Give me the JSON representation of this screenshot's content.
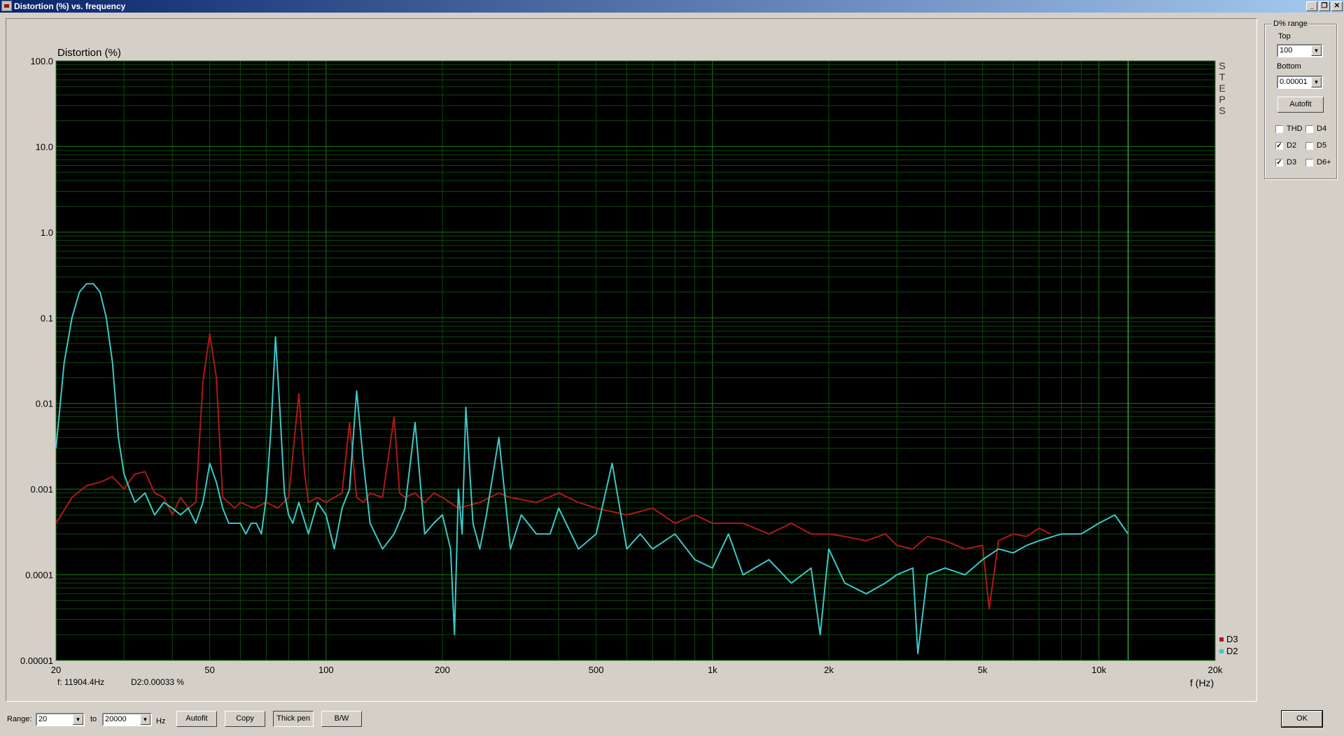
{
  "window": {
    "title": "Distortion (%) vs. frequency",
    "buttons": [
      "_",
      "❐",
      "✕"
    ]
  },
  "chart_data": {
    "type": "line",
    "title": "Distortion (%)",
    "xlabel": "f (Hz)",
    "x_scale": "log",
    "y_scale": "log",
    "xlim": [
      20,
      20000
    ],
    "ylim": [
      1e-05,
      100
    ],
    "grid": true,
    "legend_position": "bottom-right",
    "cursor_freq": 11904.4,
    "x_tick_labels": [
      {
        "v": 20,
        "t": "20"
      },
      {
        "v": 50,
        "t": "50"
      },
      {
        "v": 100,
        "t": "100"
      },
      {
        "v": 200,
        "t": "200"
      },
      {
        "v": 500,
        "t": "500"
      },
      {
        "v": 1000,
        "t": "1k"
      },
      {
        "v": 2000,
        "t": "2k"
      },
      {
        "v": 5000,
        "t": "5k"
      },
      {
        "v": 10000,
        "t": "10k"
      },
      {
        "v": 20000,
        "t": "20k"
      }
    ],
    "y_tick_labels": [
      {
        "v": 100,
        "t": "100.0"
      },
      {
        "v": 10,
        "t": "10.0"
      },
      {
        "v": 1,
        "t": "1.0"
      },
      {
        "v": 0.1,
        "t": "0.1"
      },
      {
        "v": 0.01,
        "t": "0.01"
      },
      {
        "v": 0.001,
        "t": "0.001"
      },
      {
        "v": 0.0001,
        "t": "0.0001"
      },
      {
        "v": 1e-05,
        "t": "0.00001"
      }
    ],
    "side_label": [
      "S",
      "T",
      "E",
      "P",
      "S"
    ],
    "series": [
      {
        "name": "D3",
        "color": "#b01818",
        "x": [
          20,
          22,
          24,
          26,
          28,
          30,
          32,
          34,
          36,
          38,
          40,
          42,
          44,
          46,
          48,
          50,
          52,
          54,
          56,
          58,
          60,
          65,
          70,
          75,
          80,
          85,
          88,
          90,
          95,
          100,
          105,
          110,
          115,
          120,
          125,
          130,
          140,
          150,
          155,
          160,
          170,
          180,
          190,
          200,
          220,
          250,
          280,
          300,
          350,
          400,
          450,
          500,
          600,
          700,
          800,
          900,
          1000,
          1200,
          1400,
          1600,
          1800,
          2000,
          2200,
          2500,
          2800,
          3000,
          3300,
          3600,
          4000,
          4500,
          5000,
          5200,
          5500,
          6000,
          6500,
          7000,
          7500
        ],
        "y": [
          0.0004,
          0.0008,
          0.0011,
          0.0012,
          0.0014,
          0.001,
          0.0015,
          0.0016,
          0.0009,
          0.0008,
          0.0005,
          0.0008,
          0.0006,
          0.0007,
          0.018,
          0.065,
          0.02,
          0.0008,
          0.0007,
          0.0006,
          0.0007,
          0.0006,
          0.0007,
          0.0006,
          0.0008,
          0.013,
          0.0015,
          0.0007,
          0.0008,
          0.0007,
          0.0008,
          0.0009,
          0.006,
          0.0008,
          0.0007,
          0.0009,
          0.0008,
          0.007,
          0.0009,
          0.0008,
          0.0009,
          0.0007,
          0.0009,
          0.0008,
          0.0006,
          0.0007,
          0.0009,
          0.0008,
          0.0007,
          0.0009,
          0.0007,
          0.0006,
          0.0005,
          0.0006,
          0.0004,
          0.0005,
          0.0004,
          0.0004,
          0.0003,
          0.0004,
          0.0003,
          0.0003,
          0.00028,
          0.00025,
          0.0003,
          0.00022,
          0.0002,
          0.00028,
          0.00025,
          0.0002,
          0.00022,
          4e-05,
          0.00025,
          0.0003,
          0.00028,
          0.00035,
          0.0003
        ]
      },
      {
        "name": "D2",
        "color": "#3cc8c8",
        "x": [
          20,
          21,
          22,
          23,
          24,
          25,
          26,
          27,
          28,
          29,
          30,
          31,
          32,
          34,
          36,
          38,
          40,
          42,
          44,
          46,
          48,
          50,
          52,
          54,
          56,
          58,
          60,
          62,
          64,
          66,
          68,
          70,
          72,
          74,
          76,
          78,
          80,
          82,
          85,
          90,
          95,
          100,
          105,
          110,
          115,
          120,
          125,
          130,
          140,
          150,
          160,
          170,
          180,
          190,
          200,
          210,
          215,
          220,
          225,
          230,
          240,
          250,
          260,
          280,
          300,
          320,
          350,
          380,
          400,
          450,
          500,
          550,
          600,
          650,
          700,
          800,
          900,
          1000,
          1100,
          1200,
          1400,
          1600,
          1800,
          1900,
          2000,
          2200,
          2500,
          2800,
          3000,
          3300,
          3400,
          3600,
          4000,
          4500,
          5000,
          5500,
          6000,
          6500,
          7000,
          8000,
          9000,
          10000,
          11000,
          11900
        ],
        "y": [
          0.003,
          0.03,
          0.1,
          0.2,
          0.25,
          0.25,
          0.2,
          0.1,
          0.03,
          0.004,
          0.0015,
          0.001,
          0.0007,
          0.0009,
          0.0005,
          0.0007,
          0.0006,
          0.0005,
          0.0006,
          0.0004,
          0.0007,
          0.002,
          0.0012,
          0.0006,
          0.0004,
          0.0004,
          0.0004,
          0.0003,
          0.0004,
          0.0004,
          0.0003,
          0.0008,
          0.005,
          0.06,
          0.008,
          0.0009,
          0.0005,
          0.0004,
          0.0007,
          0.0003,
          0.0007,
          0.0005,
          0.0002,
          0.0006,
          0.001,
          0.014,
          0.002,
          0.0004,
          0.0002,
          0.0003,
          0.0006,
          0.006,
          0.0003,
          0.0004,
          0.0005,
          0.0002,
          2e-05,
          0.001,
          0.0003,
          0.009,
          0.0004,
          0.0002,
          0.0005,
          0.004,
          0.0002,
          0.0005,
          0.0003,
          0.0003,
          0.0006,
          0.0002,
          0.0003,
          0.002,
          0.0002,
          0.0003,
          0.0002,
          0.0003,
          0.00015,
          0.00012,
          0.0003,
          0.0001,
          0.00015,
          8e-05,
          0.00012,
          2e-05,
          0.0002,
          8e-05,
          6e-05,
          8e-05,
          0.0001,
          0.00012,
          1.2e-05,
          0.0001,
          0.00012,
          0.0001,
          0.00015,
          0.0002,
          0.00018,
          0.00022,
          0.00025,
          0.0003,
          0.0003,
          0.0004,
          0.0005,
          0.0003
        ]
      }
    ]
  },
  "status": {
    "freq_text": "f: 11904.4Hz",
    "value_text": "D2:0.00033  %"
  },
  "panel": {
    "group_label": "D% range",
    "top_label": "Top",
    "top_value": "100",
    "bottom_label": "Bottom",
    "bottom_value": "0.00001",
    "autofit": "Autofit",
    "checkboxes": [
      {
        "label": "THD",
        "checked": false
      },
      {
        "label": "D4",
        "checked": false
      },
      {
        "label": "D2",
        "checked": true
      },
      {
        "label": "D5",
        "checked": false
      },
      {
        "label": "D3",
        "checked": true
      },
      {
        "label": "D6+",
        "checked": false
      }
    ]
  },
  "footer": {
    "range_label": "Range:",
    "range_from": "20",
    "to_label": "to",
    "range_to": "20000",
    "hz_label": "Hz",
    "autofit": "Autofit",
    "copy": "Copy",
    "thick_pen": "Thick pen",
    "bw": "B/W",
    "ok": "OK"
  }
}
